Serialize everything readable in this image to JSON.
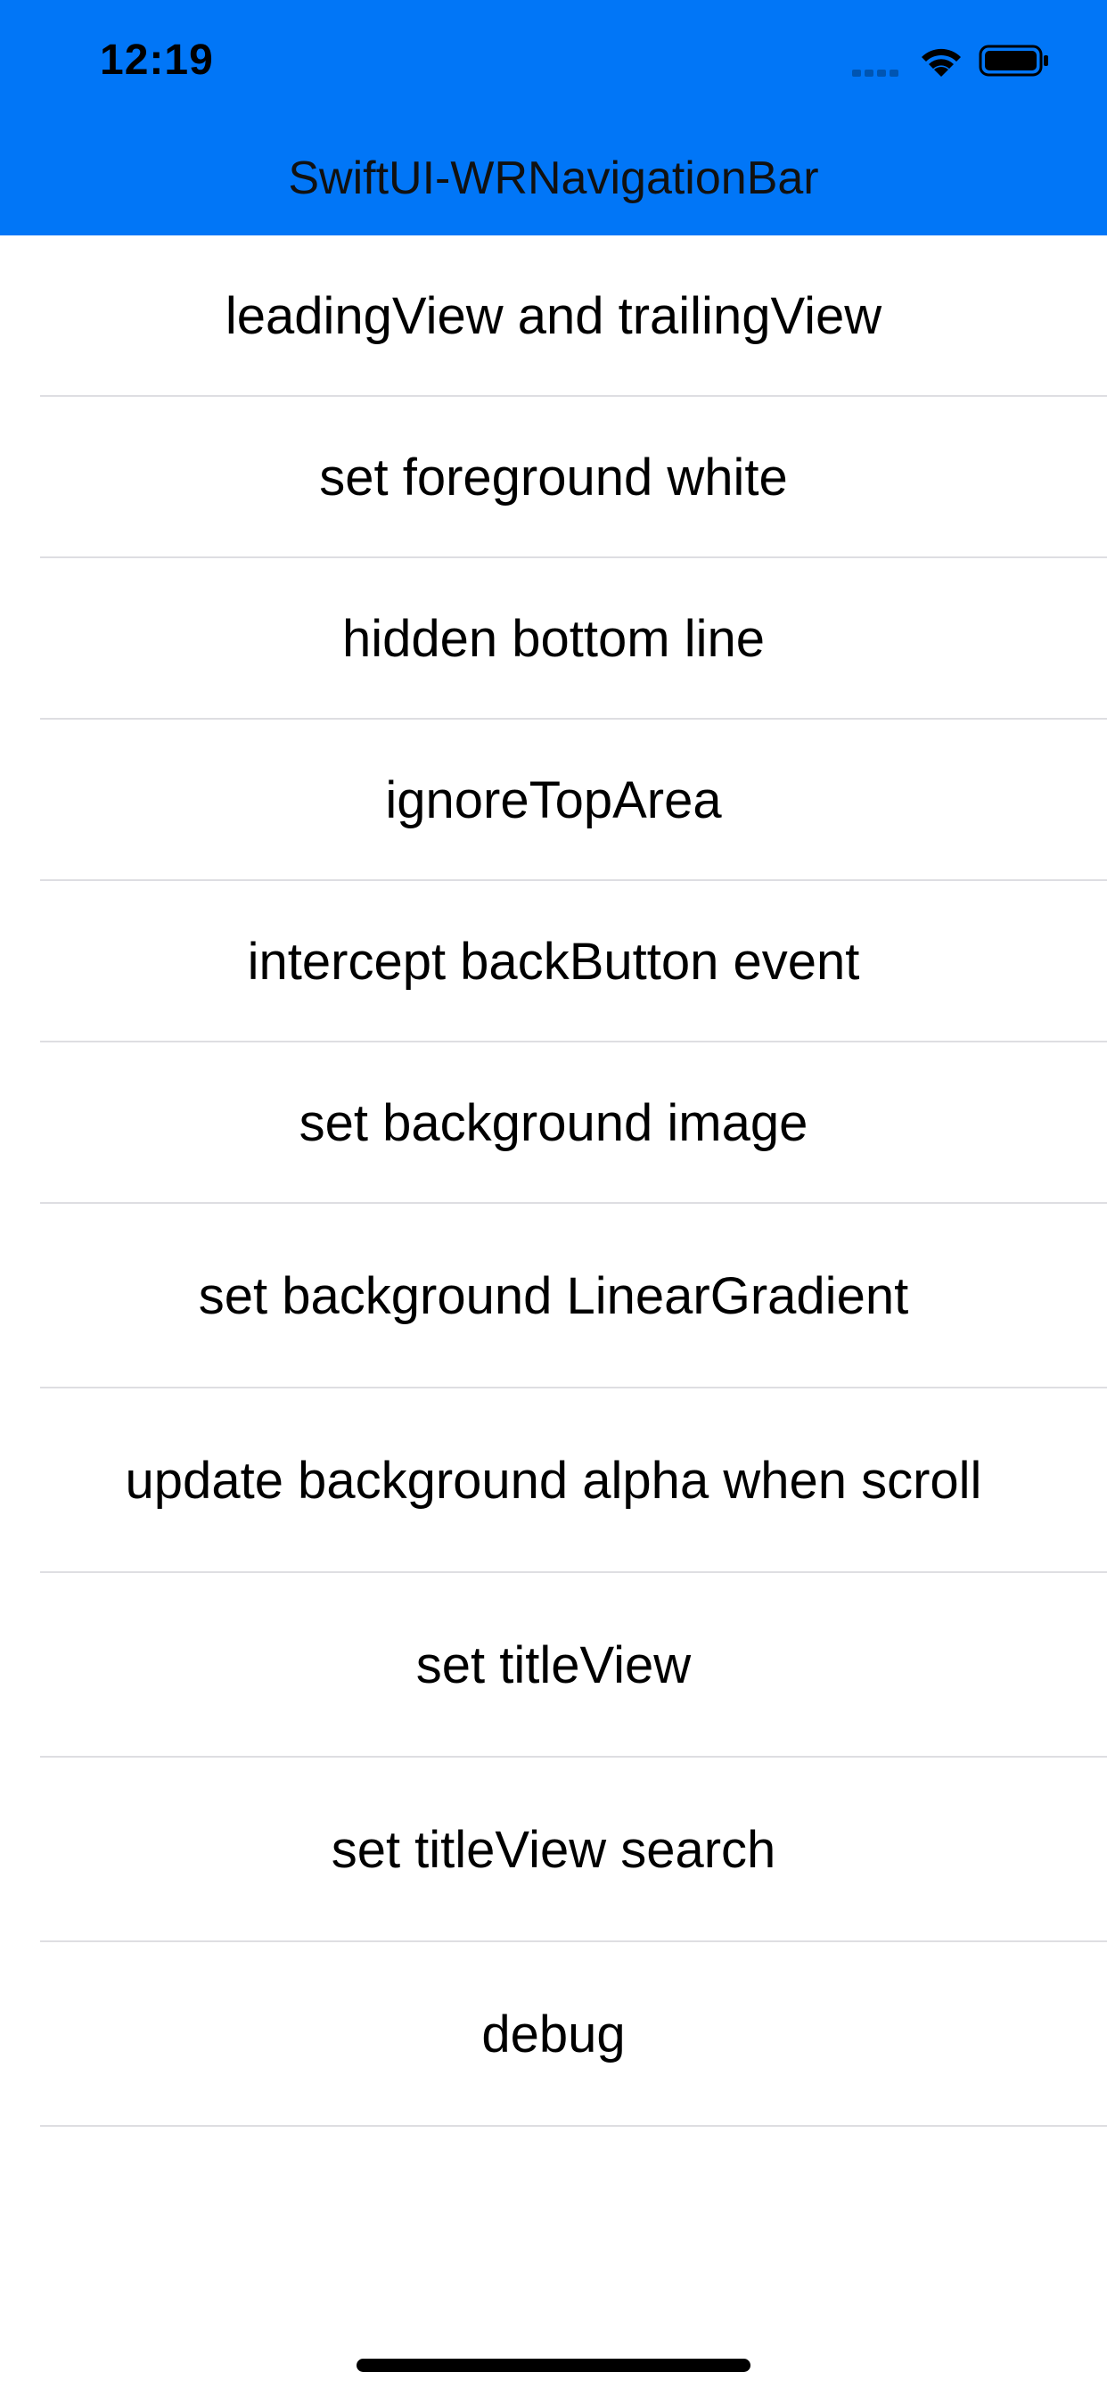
{
  "status_bar": {
    "time": "12:19",
    "icons": [
      "cellular-signal-icon",
      "wifi-icon",
      "battery-icon"
    ]
  },
  "nav_bar": {
    "title": "SwiftUI-WRNavigationBar",
    "background_color": "#0176f7"
  },
  "list": {
    "items": [
      {
        "label": "leadingView and trailingView"
      },
      {
        "label": "set foreground white"
      },
      {
        "label": "hidden bottom line"
      },
      {
        "label": "ignoreTopArea"
      },
      {
        "label": "intercept backButton event"
      },
      {
        "label": "set background image"
      },
      {
        "label": "set background LinearGradient"
      },
      {
        "label": "update background alpha when scroll"
      },
      {
        "label": "set titleView"
      },
      {
        "label": "set titleView search"
      },
      {
        "label": "debug"
      }
    ]
  }
}
